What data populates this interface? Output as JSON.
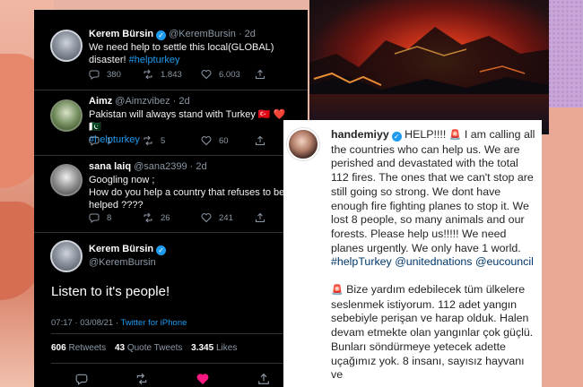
{
  "tweets": [
    {
      "name": "Kerem Bürsin",
      "handle": "@KeremBursin · 2d",
      "text": "We need help to settle this local(GLOBAL) disaster! ",
      "hashtag": "#helpturkey",
      "replies": "380",
      "retweets": "1.843",
      "likes": "6.003"
    },
    {
      "name": "Aimz",
      "handle": "@Aimzvibez · 2d",
      "text": "Pakistan will always stand with Turkey 🇹🇷 ❤️ 🇵🇰",
      "hashtag": "#helpturkey",
      "replies": "1",
      "retweets": "5",
      "likes": "60"
    },
    {
      "name": "sana laiq",
      "handle": "@sana2399 · 2d",
      "text": "Googling now ;",
      "text2": "How do you help a country that refuses to be helped ????",
      "replies": "8",
      "retweets": "26",
      "likes": "241"
    }
  ],
  "main_tweet": {
    "name": "Kerem Bürsin",
    "handle": "@KeremBursin",
    "text": "Listen to it's people!",
    "time": "07:17 · 03/08/21 · ",
    "source": "Twitter for iPhone",
    "retweets_count": "606",
    "retweets_label": "Retweets",
    "quotes_count": "43",
    "quotes_label": "Quote Tweets",
    "likes_count": "3.345",
    "likes_label": "Likes"
  },
  "instagram": {
    "username": "handemiyy",
    "p1_a": " HELP!!!! ",
    "p1_b": " I am calling all the countries who can help us. We are perished and devastated with the total 112 fires. The ones that we can't stop are still going so strong. We dont have enough fire fighting planes to stop it. We lost 8 people, so many animals and our forests. Please help us!!!!! We need planes urgently. We only have 1 world. ",
    "p1_tag1": "#helpTurkey",
    "p1_tag2": "@unitednations",
    "p1_tag3": "@eucouncil",
    "p2": " Bize yardım edebilecek tüm ülkelere seslenmek istiyorum. 112 adet yangın sebebiyle perişan ve harap olduk. Halen devam etmekte olan yangınlar çok güçlü. Bunları söndürmeye yetecek adette uçağımız yok. 8 insanı, sayısız hayvanı ve"
  },
  "colors": {
    "twitter_bg": "#000000",
    "twitter_blue": "#1d9bf0",
    "muted": "#8b98a5",
    "like_red": "#f91880",
    "ig_link": "#00376b"
  },
  "icons": [
    "verified-badge-icon",
    "reply-icon",
    "retweet-icon",
    "like-icon",
    "share-icon",
    "siren-icon"
  ]
}
